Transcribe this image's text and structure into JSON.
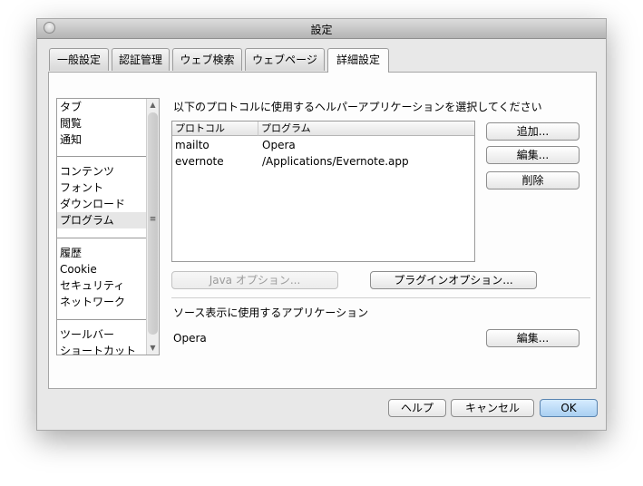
{
  "window": {
    "title": "設定"
  },
  "tabs": [
    {
      "label": "一般設定"
    },
    {
      "label": "認証管理"
    },
    {
      "label": "ウェブ検索"
    },
    {
      "label": "ウェブページ"
    },
    {
      "label": "詳細設定",
      "active": true
    }
  ],
  "sidebar": {
    "groups": [
      [
        "タブ",
        "閲覧",
        "通知"
      ],
      [
        "コンテンツ",
        "フォント",
        "ダウンロード",
        "プログラム"
      ],
      [
        "履歴",
        "Cookie",
        "セキュリティ",
        "ネットワーク"
      ],
      [
        "ツールバー",
        "ショートカット"
      ]
    ],
    "selected": "プログラム",
    "scroll_up_icon": "▲",
    "scroll_down_icon": "▼",
    "grip_icon": "≡"
  },
  "helpers": {
    "heading": "以下のプロトコルに使用するヘルパーアプリケーションを選択してください",
    "columns": [
      "プロトコル",
      "プログラム"
    ],
    "rows": [
      {
        "protocol": "mailto",
        "program": "Opera"
      },
      {
        "protocol": "evernote",
        "program": "/Applications/Evernote.app"
      }
    ],
    "add_button": "追加...",
    "edit_button": "編集...",
    "delete_button": "削除"
  },
  "options": {
    "java_button": "Java オプション...",
    "plugin_button": "プラグインオプション..."
  },
  "source": {
    "heading": "ソース表示に使用するアプリケーション",
    "app": "Opera",
    "edit_button": "編集..."
  },
  "footer": {
    "help_button": "ヘルプ",
    "cancel_button": "キャンセル",
    "ok_button": "OK"
  }
}
